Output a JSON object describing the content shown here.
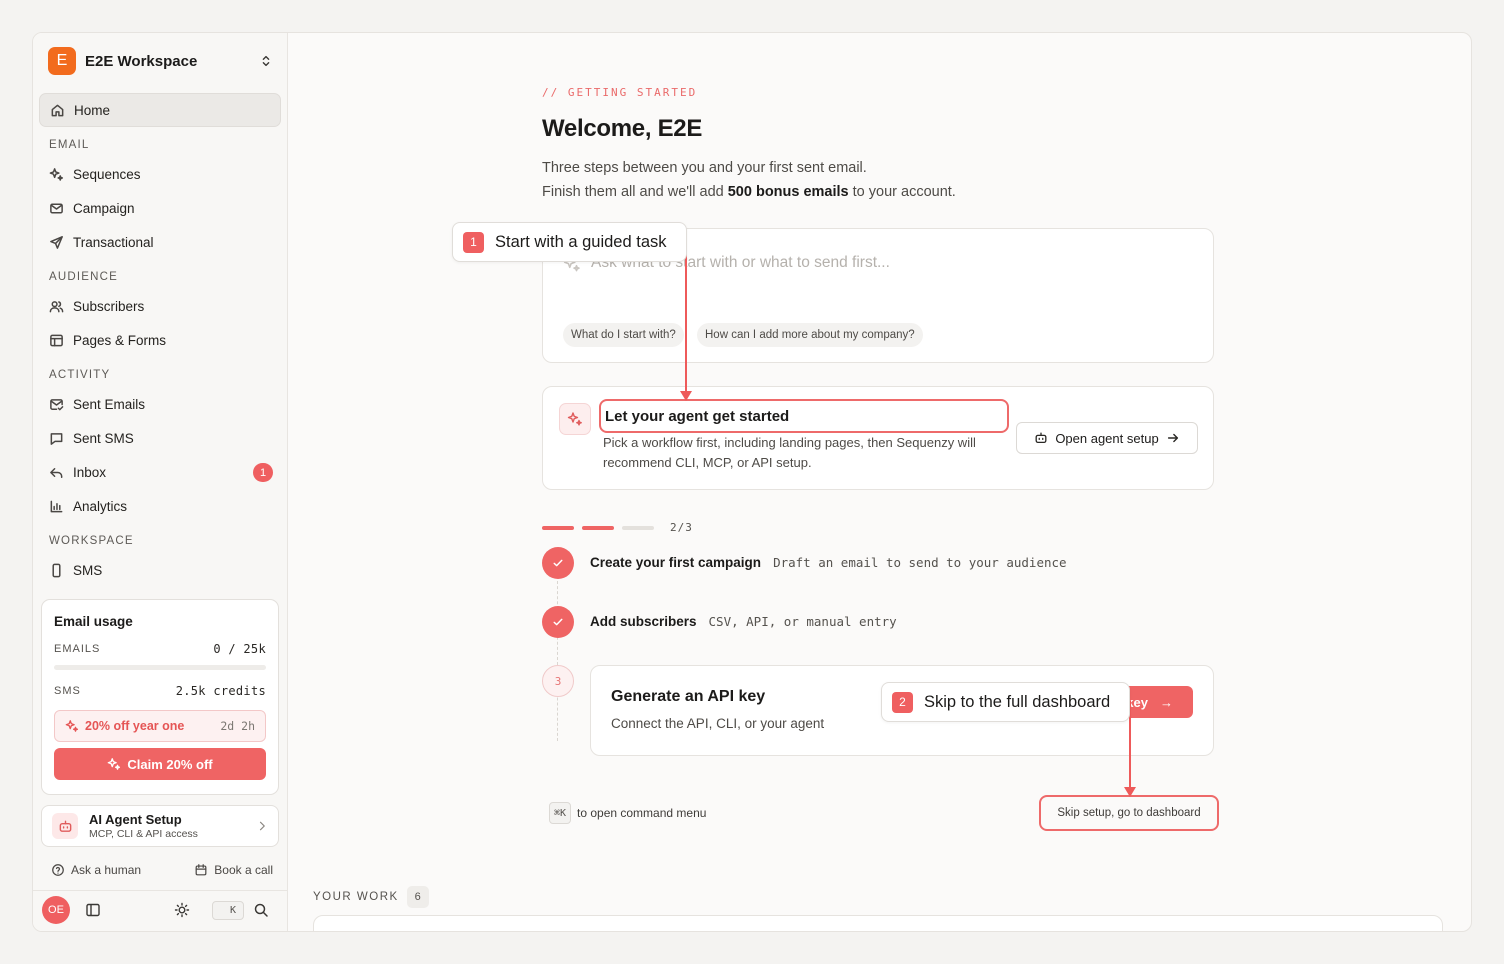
{
  "sidebar": {
    "workspace": {
      "initial": "E",
      "name": "E2E Workspace"
    },
    "home": "Home",
    "sections": [
      {
        "heading": "EMAIL",
        "items": [
          "Sequences",
          "Campaign",
          "Transactional"
        ]
      },
      {
        "heading": "AUDIENCE",
        "items": [
          "Subscribers",
          "Pages & Forms"
        ]
      },
      {
        "heading": "ACTIVITY",
        "items": [
          "Sent Emails",
          "Sent SMS",
          "Inbox",
          "Analytics"
        ]
      },
      {
        "heading": "WORKSPACE",
        "items": [
          "SMS"
        ]
      }
    ],
    "inbox_badge": "1",
    "usage": {
      "title": "Email usage",
      "emails_label": "EMAILS",
      "emails_value": "0 / 25k",
      "emails_progress": 0,
      "sms_label": "SMS",
      "sms_value": "2.5k credits",
      "promo": "20% off year one",
      "promo_timer": "2d 2h",
      "claim": "Claim 20% off"
    },
    "agent": {
      "title": "AI Agent Setup",
      "subtitle": "MCP, CLI & API access"
    },
    "help": {
      "ask": "Ask a human",
      "book": "Book a call"
    },
    "footer": {
      "avatar": "OE",
      "kbd": "K"
    }
  },
  "main": {
    "eyebrow": "// GETTING STARTED",
    "title": "Welcome, E2E",
    "sub_line1": "Three steps between you and your first sent email.",
    "sub_line2_pre": "Finish them all and we'll add ",
    "sub_line2_bold": "500 bonus emails",
    "sub_line2_post": " to your account.",
    "ask_placeholder": "Ask what to start with or what to send first...",
    "chips": [
      "What do I start with?",
      "How can I add more about my company?"
    ],
    "agent_card": {
      "title": "Let your agent get started",
      "desc": "Pick a workflow first, including landing pages, then Sequenzy will recommend CLI, MCP, or API setup.",
      "button": "Open agent setup"
    },
    "progress": {
      "label": "2/3",
      "completed": 2,
      "total": 3
    },
    "steps": [
      {
        "title": "Create your first campaign",
        "desc": "Draft an email to send to your audience",
        "status": "done"
      },
      {
        "title": "Add subscribers",
        "desc": "CSV, API, or manual entry",
        "status": "done"
      },
      {
        "title": "Generate an API key",
        "desc": "Connect the API, CLI, or your agent",
        "status": "todo",
        "number": "3",
        "button": "key",
        "button_arrow": "→"
      }
    ],
    "cmd_key": "⌘K",
    "cmd_text": "to open command menu",
    "skip": "Skip setup, go to dashboard",
    "your_work": {
      "label": "YOUR WORK",
      "count": "6"
    }
  },
  "tooltips": [
    {
      "number": "1",
      "text": "Start with a guided task"
    },
    {
      "number": "2",
      "text": "Skip to the full dashboard"
    }
  ],
  "colors": {
    "accent": "#ef6464",
    "brand": "#f26b1d"
  }
}
